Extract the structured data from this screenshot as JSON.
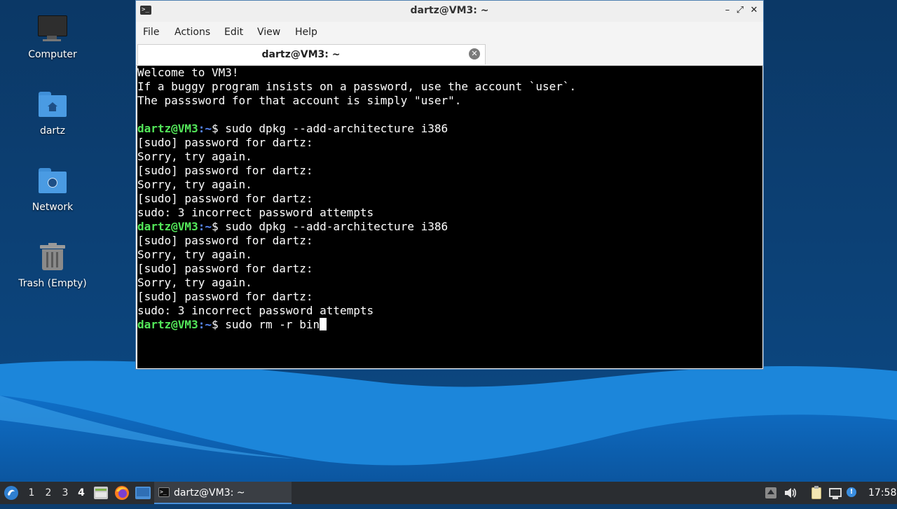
{
  "desktop": {
    "icons": [
      {
        "label": "Computer",
        "icon": "computer-icon"
      },
      {
        "label": "dartz",
        "icon": "home-folder-icon"
      },
      {
        "label": "Network",
        "icon": "network-folder-icon"
      },
      {
        "label": "Trash (Empty)",
        "icon": "trash-icon"
      }
    ]
  },
  "window": {
    "title": "dartz@VM3: ~",
    "controls": {
      "minimize": "–",
      "maximize": "⤢",
      "close": "✕"
    },
    "menu": [
      "File",
      "Actions",
      "Edit",
      "View",
      "Help"
    ],
    "tab": {
      "title": "dartz@VM3: ~",
      "close": "✕"
    }
  },
  "terminal": {
    "prompt_user": "dartz@VM3",
    "prompt_path": ":~",
    "prompt_symbol": "$ ",
    "lines": [
      {
        "type": "text",
        "text": "Welcome to VM3!"
      },
      {
        "type": "text",
        "text": "If a buggy program insists on a password, use the account `user`."
      },
      {
        "type": "text",
        "text": "The passsword for that account is simply \"user\"."
      },
      {
        "type": "text",
        "text": ""
      },
      {
        "type": "prompt",
        "text": "sudo dpkg --add-architecture i386"
      },
      {
        "type": "text",
        "text": "[sudo] password for dartz:"
      },
      {
        "type": "text",
        "text": "Sorry, try again."
      },
      {
        "type": "text",
        "text": "[sudo] password for dartz:"
      },
      {
        "type": "text",
        "text": "Sorry, try again."
      },
      {
        "type": "text",
        "text": "[sudo] password for dartz:"
      },
      {
        "type": "text",
        "text": "sudo: 3 incorrect password attempts"
      },
      {
        "type": "prompt",
        "text": "sudo dpkg --add-architecture i386"
      },
      {
        "type": "text",
        "text": "[sudo] password for dartz:"
      },
      {
        "type": "text",
        "text": "Sorry, try again."
      },
      {
        "type": "text",
        "text": "[sudo] password for dartz:"
      },
      {
        "type": "text",
        "text": "Sorry, try again."
      },
      {
        "type": "text",
        "text": "[sudo] password for dartz:"
      },
      {
        "type": "text",
        "text": "sudo: 3 incorrect password attempts"
      },
      {
        "type": "prompt-current",
        "text": "sudo rm -r bin"
      }
    ]
  },
  "taskbar": {
    "workspaces": [
      "1",
      "2",
      "3",
      "4"
    ],
    "active_workspace": "4",
    "task_label": "dartz@VM3: ~",
    "clock": "17:58",
    "tray_icons": [
      "up-arrow-icon",
      "volume-icon",
      "clipboard-icon",
      "network-icon",
      "update-notifier-icon"
    ]
  },
  "colors": {
    "prompt_user": "#54e85a",
    "prompt_path": "#5a8cff",
    "terminal_bg": "#000000",
    "taskbar_bg": "#2a2d31",
    "desktop_bg": "#0c3d6e"
  }
}
